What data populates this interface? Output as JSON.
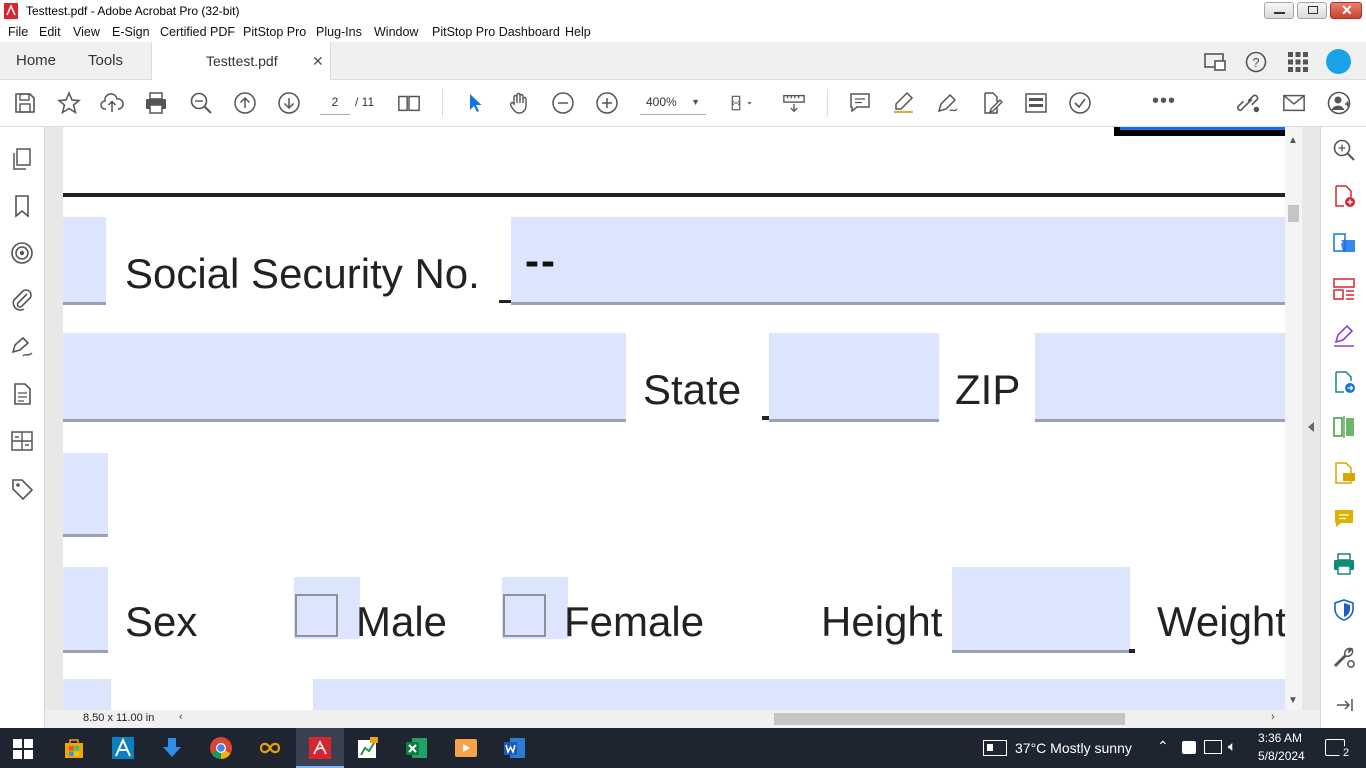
{
  "window": {
    "title": "Testtest.pdf - Adobe Acrobat Pro (32-bit)"
  },
  "menu": [
    "File",
    "Edit",
    "View",
    "E-Sign",
    "Certified PDF",
    "PitStop Pro",
    "Plug-Ins",
    "Window",
    "PitStop Pro Dashboard",
    "Help"
  ],
  "tabs": {
    "home": "Home",
    "tools": "Tools",
    "document": "Testtest.pdf"
  },
  "toolbar": {
    "page_current": "2",
    "page_total": "/ 11",
    "zoom": "400%"
  },
  "form": {
    "ssn_label": "Social Security No.",
    "ssn_value": "--",
    "state_label": "State",
    "zip_label": "ZIP",
    "sex_label": "Sex",
    "male_label": "Male",
    "female_label": "Female",
    "height_label": "Height",
    "weight_label": "Weight"
  },
  "status": {
    "page_size": "8.50 x 11.00 in"
  },
  "taskbar": {
    "weather": "37°C  Mostly sunny",
    "time": "3:36 AM",
    "date": "5/8/2024",
    "notifications": "2"
  },
  "colors": {
    "field_fill": "#dde4fd",
    "acrobat_red": "#d7262f",
    "taskbar_bg": "#1e2430"
  }
}
